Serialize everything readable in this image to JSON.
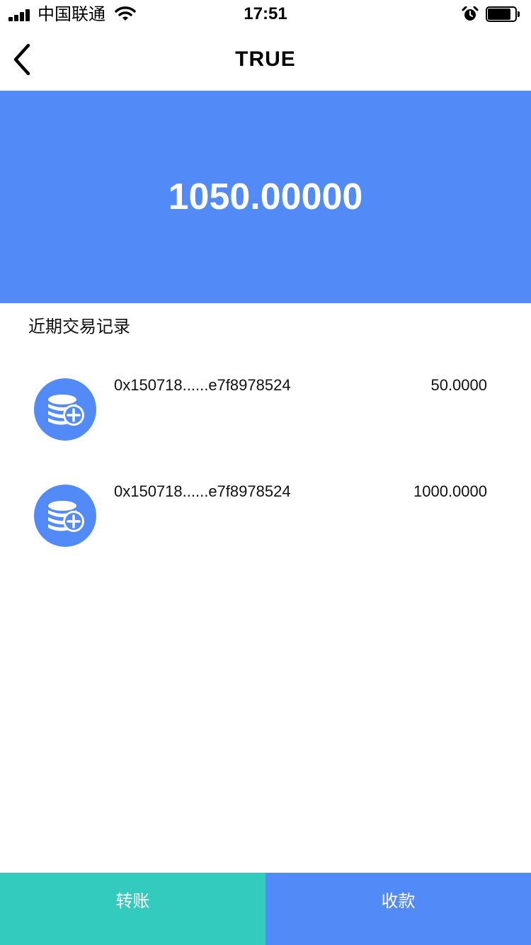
{
  "status_bar": {
    "carrier": "中国联通",
    "time": "17:51",
    "icons": [
      "signal-icon",
      "wifi-icon",
      "alarm-icon",
      "battery-icon"
    ],
    "battery_level": 0.85
  },
  "nav": {
    "title": "TRUE",
    "back_icon": "chevron-left-icon"
  },
  "balance": {
    "amount": "1050.00000"
  },
  "records": {
    "title": "近期交易记录",
    "icon": "coins-add-icon",
    "items": [
      {
        "hash": "0x150718......e7f8978524",
        "amount": "50.0000"
      },
      {
        "hash": "0x150718......e7f8978524",
        "amount": "1000.0000"
      }
    ]
  },
  "actions": {
    "transfer_label": "转账",
    "receive_label": "收款"
  },
  "colors": {
    "primary": "#528bf7",
    "transfer_button": "#34cbbf",
    "receive_button": "#528bf7",
    "banner": "#528bf7",
    "text": "#111111"
  }
}
